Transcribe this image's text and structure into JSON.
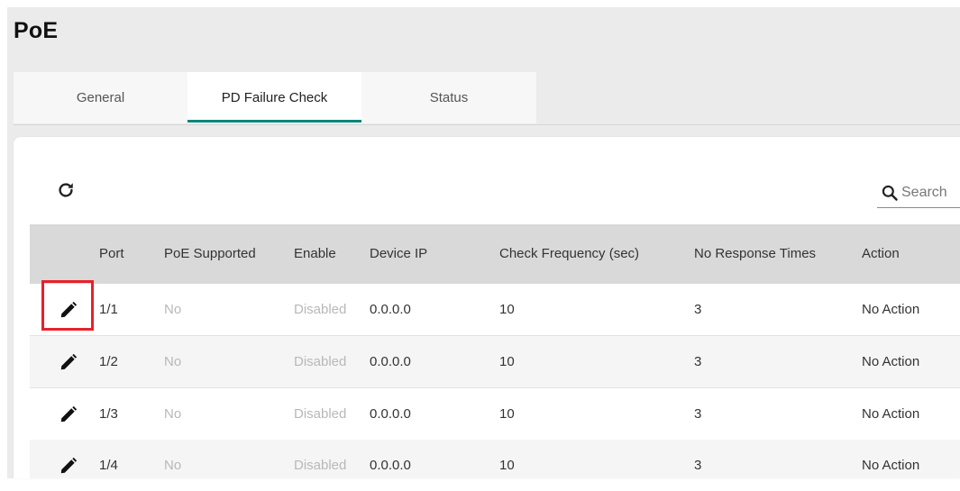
{
  "page": {
    "title": "PoE"
  },
  "tabs": [
    {
      "label": "General",
      "active": false
    },
    {
      "label": "PD Failure Check",
      "active": true
    },
    {
      "label": "Status",
      "active": false
    }
  ],
  "toolbar": {
    "refresh_icon": "refresh-icon"
  },
  "search": {
    "placeholder": "Search",
    "value": "",
    "icon": "search-icon"
  },
  "table": {
    "columns": [
      "",
      "Port",
      "PoE Supported",
      "Enable",
      "Device IP",
      "Check Frequency (sec)",
      "No Response Times",
      "Action"
    ],
    "rows": [
      {
        "port": "1/1",
        "poe_supported": "No",
        "enable": "Disabled",
        "device_ip": "0.0.0.0",
        "check_frequency": "10",
        "no_response_times": "3",
        "action": "No Action",
        "highlighted": true
      },
      {
        "port": "1/2",
        "poe_supported": "No",
        "enable": "Disabled",
        "device_ip": "0.0.0.0",
        "check_frequency": "10",
        "no_response_times": "3",
        "action": "No Action",
        "highlighted": false
      },
      {
        "port": "1/3",
        "poe_supported": "No",
        "enable": "Disabled",
        "device_ip": "0.0.0.0",
        "check_frequency": "10",
        "no_response_times": "3",
        "action": "No Action",
        "highlighted": false
      },
      {
        "port": "1/4",
        "poe_supported": "No",
        "enable": "Disabled",
        "device_ip": "0.0.0.0",
        "check_frequency": "10",
        "no_response_times": "3",
        "action": "No Action",
        "highlighted": false
      }
    ]
  },
  "colors": {
    "accent": "#00857a",
    "highlight_border": "#e8202a",
    "header_bg": "#d9d9d9",
    "page_bg": "#ebebeb",
    "muted_text": "#b8b8b8"
  }
}
